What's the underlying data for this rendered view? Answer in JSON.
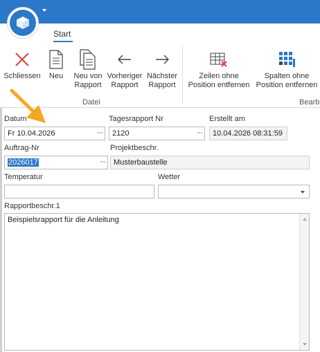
{
  "ribbon": {
    "tab": "Start",
    "buttons": {
      "close": "Schliessen",
      "new": "Neu",
      "new_from_report_line1": "Neu von",
      "new_from_report_line2": "Rapport",
      "previous_line1": "Vorheriger",
      "previous_line2": "Rapport",
      "next_line1": "Nächster",
      "next_line2": "Rapport",
      "rows_line1": "Zeilen ohne",
      "rows_line2": "Position entfernen",
      "cols_line1": "Spalten ohne",
      "cols_line2": "Position entfernen"
    },
    "groups": {
      "file": "Datei",
      "edit": "Bearb"
    }
  },
  "form": {
    "date_label": "Datum",
    "date_value": "Fr 10.04.2026",
    "report_no_label": "Tagesrapport Nr",
    "report_no_value": "2120",
    "created_label": "Erstellt am",
    "created_value": "10.04.2026 08:31:59",
    "order_label": "Auftrag-Nr",
    "order_value": "2026017",
    "project_label": "Projektbeschr.",
    "project_value": "Musterbaustelle",
    "temperature_label": "Temperatur",
    "temperature_value": "",
    "weather_label": "Wetter",
    "weather_value": "",
    "description_label": "Rapportbeschr.1",
    "description_value": "Beispielsrapport für die Anleitung",
    "ellipsis": "···"
  },
  "colors": {
    "titlebar": "#2b78c8",
    "close_icon": "#e0413a",
    "arrow_annotation": "#f5a623"
  }
}
